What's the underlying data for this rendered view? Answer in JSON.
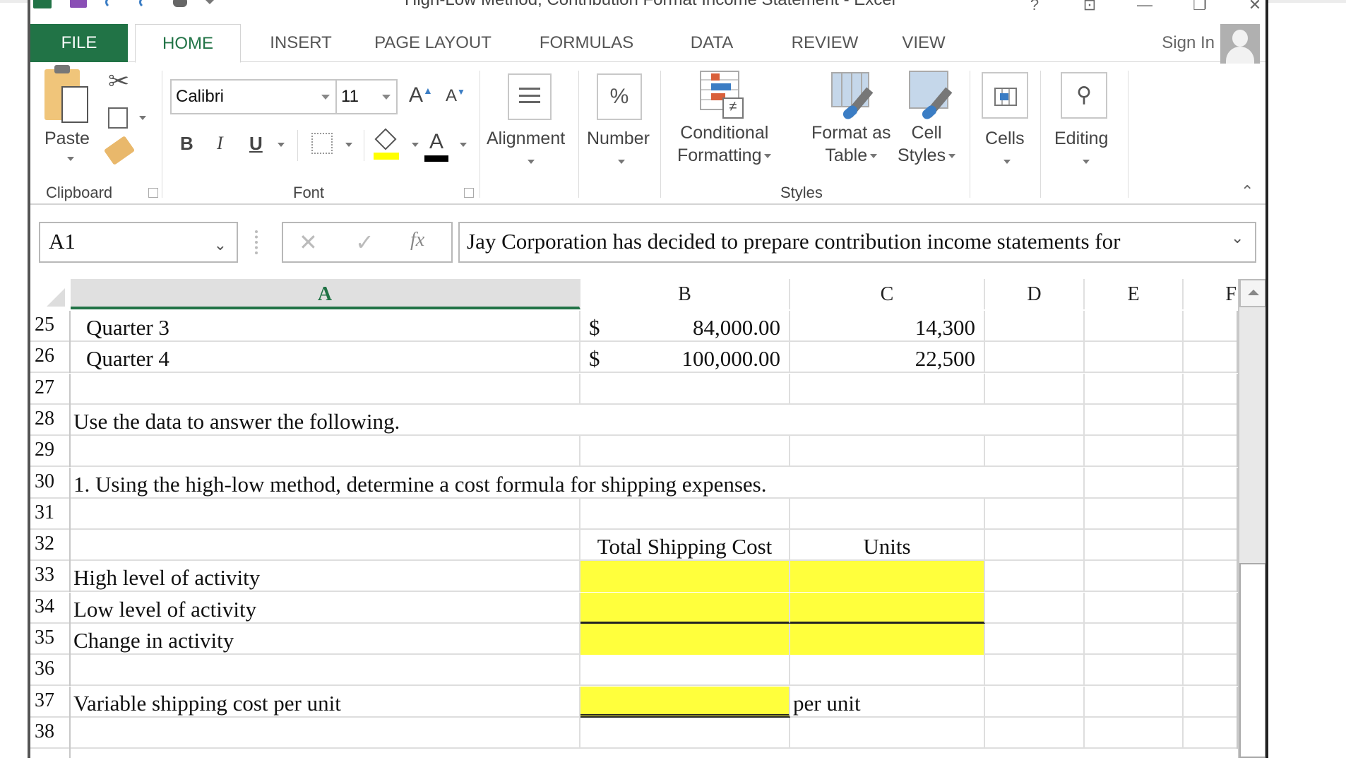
{
  "window": {
    "title": "High-Low Method, Contribution Format Income Statement - Excel",
    "controls": [
      "help-icon",
      "ribbon-display-icon",
      "minimize-icon",
      "restore-icon",
      "close-icon"
    ]
  },
  "quick_access": [
    "excel-logo",
    "save-icon",
    "undo-icon",
    "redo-icon",
    "touch-mode-icon",
    "customize-dropdown"
  ],
  "tabs": [
    {
      "label": "FILE"
    },
    {
      "label": "HOME",
      "active": true
    },
    {
      "label": "INSERT"
    },
    {
      "label": "PAGE LAYOUT"
    },
    {
      "label": "FORMULAS"
    },
    {
      "label": "DATA"
    },
    {
      "label": "REVIEW"
    },
    {
      "label": "VIEW"
    }
  ],
  "account": {
    "sign_in": "Sign In"
  },
  "ribbon": {
    "clipboard": {
      "group": "Clipboard",
      "paste": "Paste"
    },
    "font": {
      "group": "Font",
      "font_name": "Calibri",
      "font_size": "11",
      "bold": "B",
      "italic": "I",
      "underline": "U",
      "grow": "A",
      "shrink": "A",
      "font_color": "A",
      "fill_color": "#ffff00",
      "text_color": "#000000"
    },
    "alignment": {
      "label": "Alignment"
    },
    "number": {
      "label": "Number",
      "icon_text": "%"
    },
    "styles": {
      "group": "Styles",
      "conditional_1": "Conditional",
      "conditional_2": "Formatting",
      "format_table_1": "Format as",
      "format_table_2": "Table",
      "cell_styles_1": "Cell",
      "cell_styles_2": "Styles"
    },
    "cells": {
      "label": "Cells"
    },
    "editing": {
      "label": "Editing"
    }
  },
  "formula_bar": {
    "name_box": "A1",
    "cancel": "✕",
    "enter": "✓",
    "fx": "fx",
    "content": "Jay Corporation  has decided to prepare contribution income statements for"
  },
  "sheet": {
    "columns": [
      "A",
      "B",
      "C",
      "D",
      "E",
      "F"
    ],
    "selected_column": "A",
    "rows": [
      {
        "num": "25",
        "a": "Quarter 3",
        "b_sym": "$",
        "b": "84,000.00",
        "c": "14,300"
      },
      {
        "num": "26",
        "a": "Quarter 4",
        "b_sym": "$",
        "b": "100,000.00",
        "c": "22,500"
      },
      {
        "num": "27"
      },
      {
        "num": "28",
        "a": "Use the data to answer the following."
      },
      {
        "num": "29"
      },
      {
        "num": "30",
        "a": "1. Using the high-low method, determine a cost formula for shipping expenses."
      },
      {
        "num": "31"
      },
      {
        "num": "32",
        "b": "Total Shipping Cost",
        "c": "Units"
      },
      {
        "num": "33",
        "a": "High level of activity",
        "b": "",
        "c": ""
      },
      {
        "num": "34",
        "a": "Low level of activity",
        "b": "",
        "c": ""
      },
      {
        "num": "35",
        "a": "Change in activity",
        "b": "",
        "c": ""
      },
      {
        "num": "36"
      },
      {
        "num": "37",
        "a": "Variable shipping cost per unit",
        "b": "",
        "c": "per unit"
      },
      {
        "num": "38"
      }
    ],
    "input_fill_color": "#ffff3c"
  }
}
